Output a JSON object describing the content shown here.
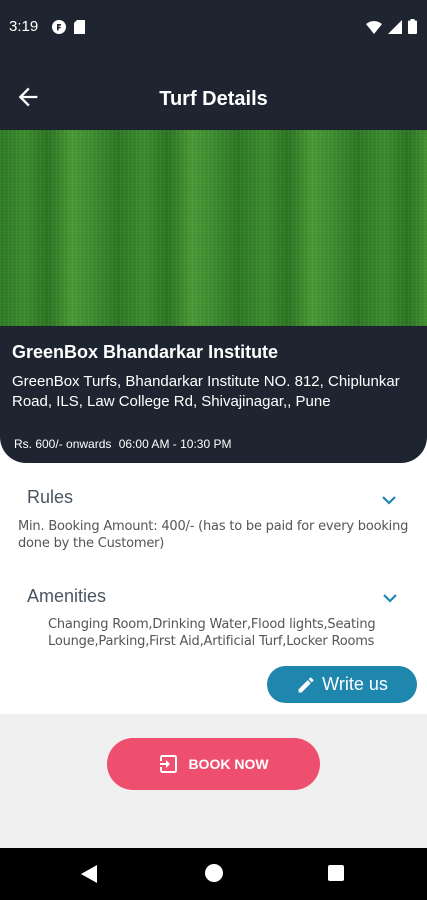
{
  "status_bar": {
    "time": "3:19"
  },
  "app_bar": {
    "title": "Turf Details"
  },
  "turf": {
    "name": "GreenBox Bhandarkar Institute",
    "address": "GreenBox Turfs, Bhandarkar Institute NO. 812, Chiplunkar Road, ILS, Law College Rd, Shivajinagar,, Pune",
    "price": "Rs. 600/- onwards",
    "timing": "06:00 AM - 10:30 PM"
  },
  "rules": {
    "title": "Rules",
    "text": "Min. Booking Amount: 400/- (has to be paid for every booking done by the Customer)"
  },
  "amenities": {
    "title": "Amenities",
    "text": "Changing Room,Drinking Water,Flood lights,Seating Lounge,Parking,First Aid,Artificial Turf,Locker Rooms"
  },
  "actions": {
    "write_label": "Write us",
    "book_label": "BOOK NOW"
  },
  "colors": {
    "header_bg": "#1e2530",
    "write_button": "#1f86ad",
    "book_button": "#ef4f6f",
    "chevron": "#1f86ad"
  },
  "icons": {
    "back": "arrow-left-icon",
    "rules_toggle": "chevron-down-icon",
    "amenities_toggle": "chevron-down-icon",
    "write": "pencil-icon",
    "book": "login-arrow-icon"
  }
}
